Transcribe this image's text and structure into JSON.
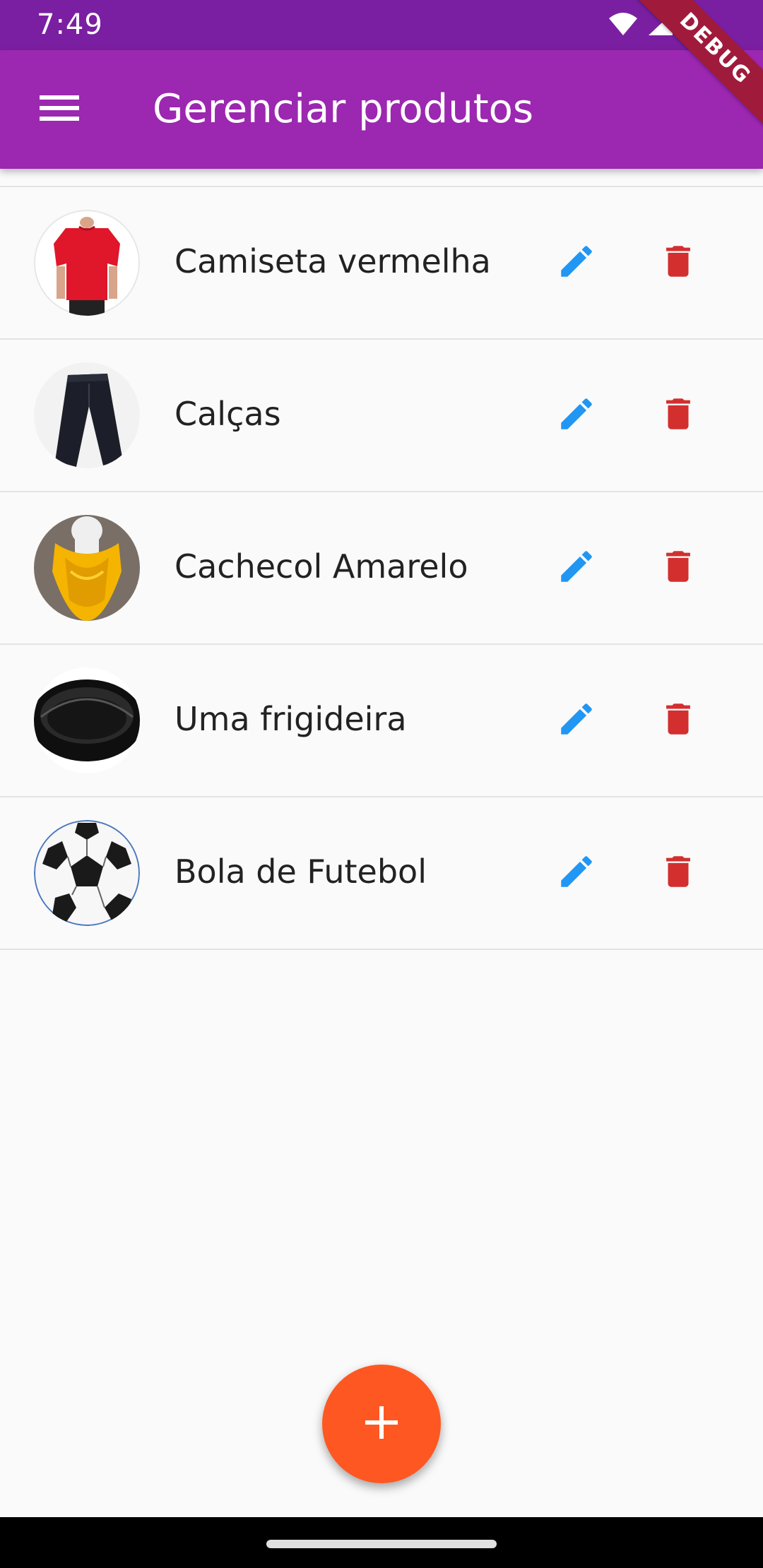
{
  "status_bar": {
    "time": "7:49"
  },
  "app_bar": {
    "title": "Gerenciar produtos",
    "menu_icon": "menu-icon"
  },
  "debug_banner": "DEBUG",
  "products": [
    {
      "name": "Camiseta vermelha",
      "image": "red-tshirt-image"
    },
    {
      "name": "Calças",
      "image": "black-pants-image"
    },
    {
      "name": "Cachecol Amarelo",
      "image": "yellow-scarf-image"
    },
    {
      "name": "Uma frigideira",
      "image": "frying-pan-image"
    },
    {
      "name": "Bola de Futebol",
      "image": "soccer-ball-image"
    }
  ],
  "actions": {
    "edit_icon": "pencil-icon",
    "delete_icon": "trash-icon"
  },
  "fab": {
    "icon": "plus-icon"
  },
  "colors": {
    "status_bar": "#7b1fa2",
    "app_bar": "#9c27b0",
    "edit": "#2196f3",
    "delete": "#d32f2f",
    "fab": "#ff5722",
    "background": "#fafafa"
  }
}
